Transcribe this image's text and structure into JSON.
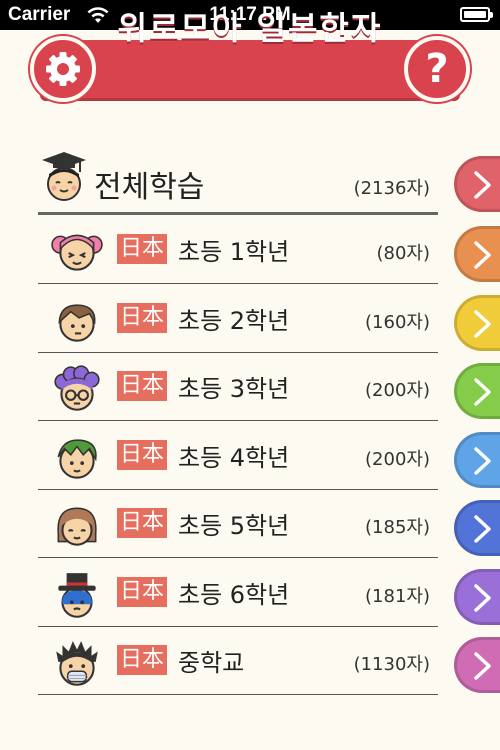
{
  "status_bar": {
    "carrier": "Carrier",
    "time": "11:17 PM"
  },
  "header": {
    "title": "위로모아 일본한자",
    "settings_icon": "gear-icon",
    "help_label": "?",
    "color": "#d9434e"
  },
  "all_study": {
    "label": "전체학습",
    "count": "(2136자)",
    "arrow_color": "#e0636a"
  },
  "grades": [
    {
      "badge": "日本",
      "label": "초등 1학년",
      "count": "(80자)",
      "arrow_color": "#e8904f",
      "avatar": "pink-pigtails-girl-avatar"
    },
    {
      "badge": "日本",
      "label": "초등 2학년",
      "count": "(160자)",
      "arrow_color": "#f0cc3a",
      "avatar": "brown-hair-boy-avatar"
    },
    {
      "badge": "日本",
      "label": "초등 3학년",
      "count": "(200자)",
      "arrow_color": "#84cc4a",
      "avatar": "purple-curly-hair-glasses-avatar"
    },
    {
      "badge": "日本",
      "label": "초등 4학년",
      "count": "(200자)",
      "arrow_color": "#5ea4e6",
      "avatar": "green-hair-boy-avatar"
    },
    {
      "badge": "日本",
      "label": "초등 5학년",
      "count": "(185자)",
      "arrow_color": "#5273d8",
      "avatar": "brown-bob-girl-avatar"
    },
    {
      "badge": "日本",
      "label": "초등 6학년",
      "count": "(181자)",
      "arrow_color": "#9b6fd8",
      "avatar": "top-hat-boy-avatar"
    },
    {
      "badge": "日本",
      "label": "중학교",
      "count": "(1130자)",
      "arrow_color": "#d06cb3",
      "avatar": "spiky-hair-mask-avatar"
    }
  ]
}
